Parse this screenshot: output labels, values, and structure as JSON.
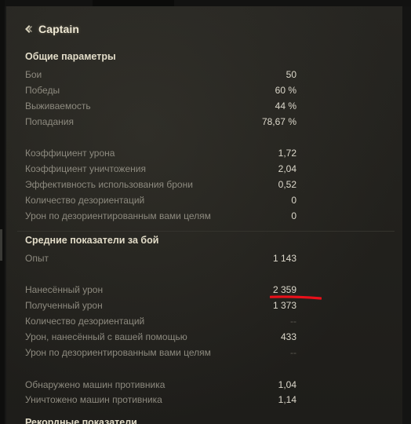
{
  "header": {
    "title": "Captain"
  },
  "general": {
    "title": "Общие параметры",
    "rows": [
      {
        "label": "Бои",
        "value": "50"
      },
      {
        "label": "Победы",
        "value": "60 %"
      },
      {
        "label": "Выживаемость",
        "value": "44 %"
      },
      {
        "label": "Попадания",
        "value": "78,67 %"
      },
      {
        "label": "Коэффициент урона",
        "value": "1,72"
      },
      {
        "label": "Коэффициент уничтожения",
        "value": "2,04"
      },
      {
        "label": "Эффективность использования брони",
        "value": "0,52"
      },
      {
        "label": "Количество дезориентаций",
        "value": "0"
      },
      {
        "label": "Урон по дезориентированным вами целям",
        "value": "0"
      }
    ]
  },
  "average": {
    "title": "Средние показатели за бой",
    "rows": [
      {
        "label": "Опыт",
        "value": "1 143"
      },
      {
        "label": "Нанесённый урон",
        "value": "2 359"
      },
      {
        "label": "Полученный урон",
        "value": "1 373"
      },
      {
        "label": "Количество дезориентаций",
        "value": "--"
      },
      {
        "label": "Урон, нанесённый с вашей помощью",
        "value": "433"
      },
      {
        "label": "Урон по дезориентированным вами целям",
        "value": "--"
      },
      {
        "label": "Обнаружено машин противника",
        "value": "1,04"
      },
      {
        "label": "Уничтожено машин противника",
        "value": "1,14"
      }
    ]
  },
  "next_section": {
    "title": "Рекордные показатели"
  },
  "colors": {
    "title": "#ece6d2",
    "label": "#8d8a7f",
    "value": "#ddd9cc",
    "highlight_underline": "#e8101a"
  }
}
